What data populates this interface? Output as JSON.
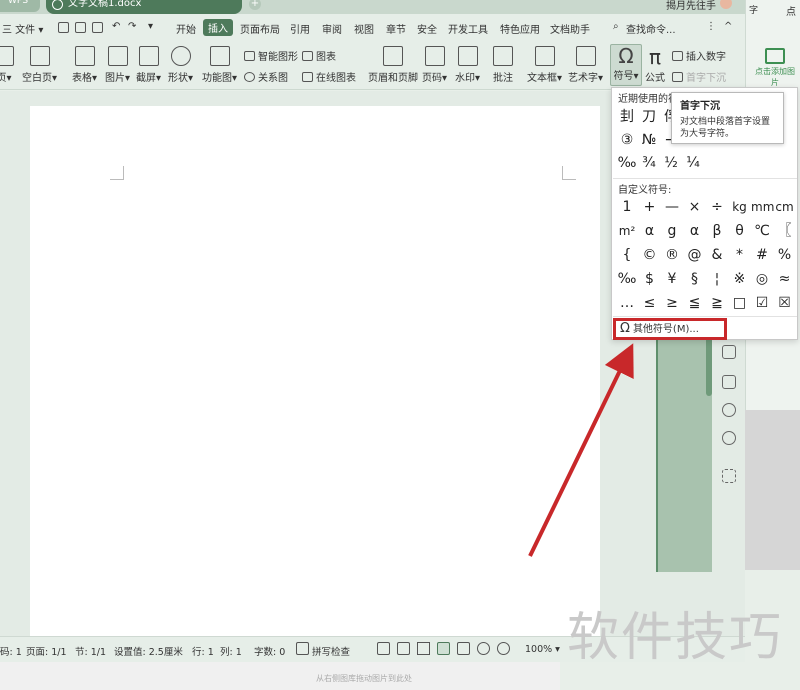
{
  "titlebar": {
    "app_tab": "WPS",
    "doc_tab": "文字文稿1.docx",
    "add_tab": "+",
    "user_name": "揭月先往手"
  },
  "menu": {
    "file": "三 文件 ▾",
    "items": [
      "开始",
      "插入",
      "页面布局",
      "引用",
      "审阅",
      "视图",
      "章节",
      "安全",
      "开发工具",
      "特色应用",
      "文档助手"
    ],
    "active_index": 1,
    "search": "查找命令...",
    "more": "⋮",
    "collapse": "^"
  },
  "ribbon": {
    "buttons": [
      "页▾",
      "空白页▾",
      "表格▾",
      "图片▾",
      "截屏▾",
      "形状▾",
      "功能图▾",
      "页眉和页脚",
      "页码▾",
      "水印▾",
      "批注",
      "文本框▾",
      "艺术字▾",
      "符号▾",
      "公式"
    ],
    "smart_graphic": "智能图形",
    "chart": "图表",
    "relation": "关系图",
    "online_chart": "在线图表",
    "insert_number": "插入数字",
    "dropcap": "首字下沉"
  },
  "symbol_menu": {
    "recent_title": "近期使用的符号",
    "recent_row1": [
      "刲",
      "刀",
      "俘"
    ],
    "recent_row2": [
      "③",
      "№",
      "→"
    ],
    "recent_row3": [
      "‰",
      "¾",
      "½",
      "¼"
    ],
    "custom_title": "自定义符号:",
    "grid": [
      [
        "1",
        "+",
        "—",
        "×",
        "÷",
        "kg",
        "mm",
        "cm"
      ],
      [
        "m²",
        "α",
        "g",
        "α",
        "β",
        "θ",
        "℃",
        "〖"
      ],
      [
        "{",
        "©",
        "®",
        "@",
        "&",
        "*",
        "#",
        "%"
      ],
      [
        "‰",
        "$",
        "¥",
        "§",
        "¦",
        "※",
        "◎",
        "≈"
      ],
      [
        "…",
        "≤",
        "≥",
        "≦",
        "≧",
        "□",
        "☑",
        "☒"
      ]
    ],
    "other": "其他符号(M)...",
    "other_icon": "Ω"
  },
  "tooltip": {
    "title": "首字下沉",
    "desc": "对文档中段落首字设置为大号字符。"
  },
  "side_panel": {
    "top_text": "字",
    "top_text2": "点",
    "add_picture": "点击添加图片"
  },
  "status": {
    "col": "码: 1",
    "page": "页面: 1/1",
    "section": "节: 1/1",
    "setting": "设置值: 2.5厘米",
    "row": "行: 1",
    "column": "列: 1",
    "words": "字数: 0",
    "spell": "拼写检查",
    "zoom": "100% ▾",
    "minus": "—"
  },
  "bottom_hint": "从右侧图库拖动图片到此处",
  "watermark": "软件技巧",
  "colors": {
    "accent": "#4e7a5b",
    "highlight_box": "#c8282a",
    "arrow": "#c8282a"
  }
}
